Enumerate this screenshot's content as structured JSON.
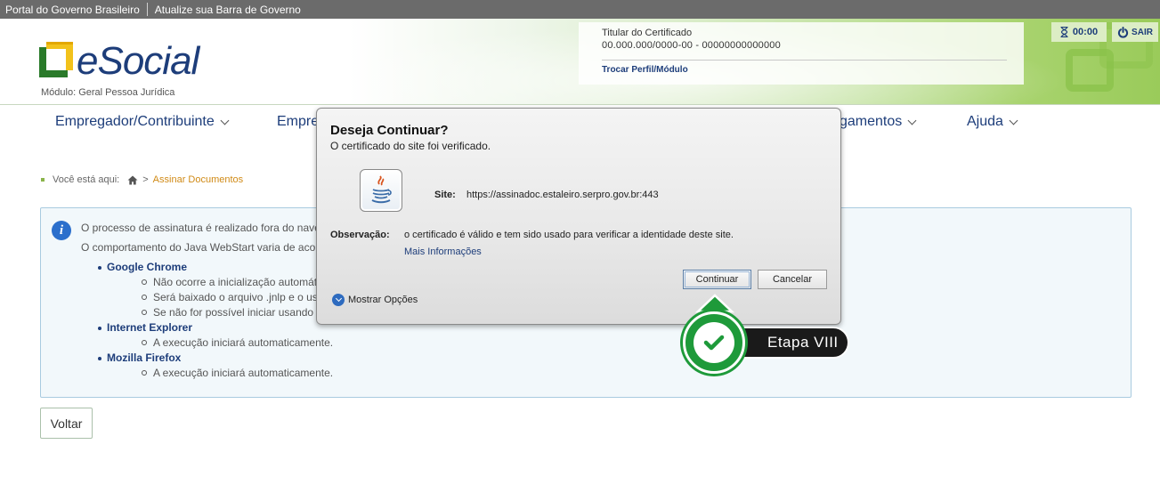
{
  "govbar": {
    "portal": "Portal do Governo Brasileiro",
    "atualize": "Atualize sua Barra de Governo"
  },
  "header": {
    "logo_text": "eSocial",
    "modulo": "Módulo: Geral Pessoa Jurídica",
    "cert_title": "Titular do Certificado",
    "cert_value": "00.000.000/0000-00 - 00000000000000",
    "trocar": "Trocar Perfil/Módulo",
    "timer": "00:00",
    "sair": "SAIR"
  },
  "nav": {
    "items": [
      {
        "label": "Empregador/Contribuinte"
      },
      {
        "label": "Empre"
      },
      {
        "label": "gamentos"
      },
      {
        "label": "Ajuda"
      }
    ]
  },
  "breadcrumb": {
    "prefix": "Você está aqui:",
    "sep": ">",
    "current": "Assinar Documentos"
  },
  "info": {
    "line1": "O processo de assinatura é realizado fora do nave",
    "line2": "O comportamento do Java WebStart varia de acor",
    "chrome": "Google Chrome",
    "chrome_items": [
      "Não ocorre a inicialização automát",
      "Será baixado o arquivo .jnlp e o usu",
      "Se não for possível iniciar usando o"
    ],
    "ie": "Internet Explorer",
    "ie_item": "A execução iniciará automaticamente.",
    "firefox": "Mozilla Firefox",
    "firefox_item": "A execução iniciará automaticamente."
  },
  "voltar": "Voltar",
  "dialog": {
    "title": "Deseja Continuar?",
    "subtitle": "O certificado do site foi verificado.",
    "site_label": "Site:",
    "site_value": "https://assinadoc.estaleiro.serpro.gov.br:443",
    "obs_label": "Observação:",
    "obs_value": "o certificado é válido e tem sido usado para verificar a identidade deste site.",
    "mais_info": "Mais Informações",
    "continuar": "Continuar",
    "cancelar": "Cancelar",
    "mostrar": "Mostrar Opções"
  },
  "step": {
    "label": "Etapa VIII"
  },
  "colors": {
    "brand_blue": "#1d3d7a",
    "brand_green": "#2a7a2a",
    "step_green": "#1e9a3a",
    "breadcrumb_orange": "#d08a16"
  }
}
